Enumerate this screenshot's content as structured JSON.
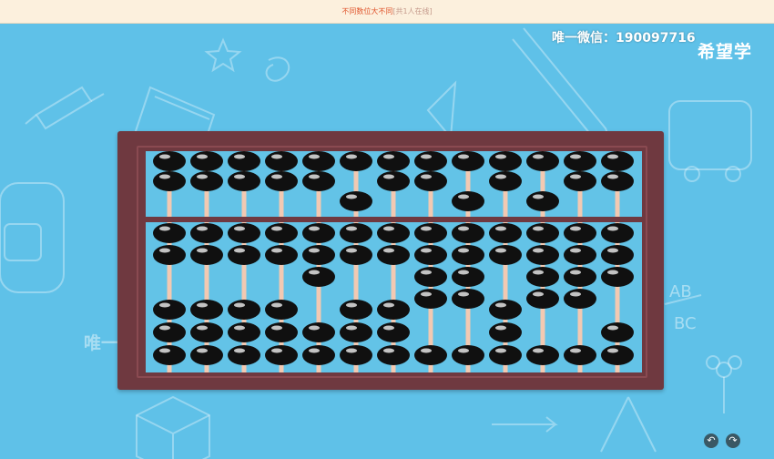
{
  "header": {
    "title": "不同数位大不同",
    "count": "[共1人在线]"
  },
  "watermark": {
    "top": "唯一微信：190097716",
    "middle": "唯一微信：190097716"
  },
  "brand": {
    "logo": "希望学"
  },
  "abacus": {
    "rods": 13,
    "upper_active": [
      0,
      0,
      0,
      0,
      0,
      1,
      0,
      0,
      1,
      0,
      1,
      0,
      0
    ],
    "lower_active": [
      2,
      2,
      2,
      2,
      3,
      2,
      2,
      4,
      4,
      2,
      4,
      4,
      3
    ],
    "colors": {
      "frame": "#6f3940",
      "bead": "#101010",
      "rod": "#f2c9b2",
      "panel": "#63c3e7"
    }
  },
  "controls": {
    "prev_icon": "undo-arrow-icon",
    "next_icon": "redo-arrow-icon",
    "prev_glyph": "↶",
    "next_glyph": "↷"
  }
}
